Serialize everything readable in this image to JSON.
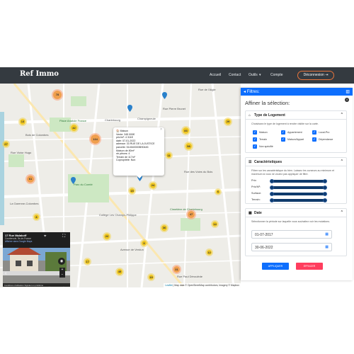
{
  "navbar": {
    "brand": "Ref Immo",
    "links": [
      "Accueil",
      "Contact",
      "Outils",
      "Compte"
    ],
    "outils_caret": "▾",
    "logout_label": "Déconnexion"
  },
  "map": {
    "places": [
      {
        "text": "Place Anatole France",
        "style": "green"
      },
      {
        "text": "Cimetière de Charlebourg",
        "style": "green"
      },
      {
        "text": "Champigneule",
        "style": ""
      },
      {
        "text": "Rue Pierre Brunet",
        "style": ""
      },
      {
        "text": "Charlebourg",
        "style": ""
      },
      {
        "text": "Rue Victor Hugo",
        "style": ""
      },
      {
        "text": "Parc du Comté",
        "style": "green"
      },
      {
        "text": "Bois de Colombes",
        "style": ""
      },
      {
        "text": "La Garenne-Colombes",
        "style": ""
      },
      {
        "text": "Rue de l'Aigle",
        "style": ""
      },
      {
        "text": "Rue des Voies du Bois",
        "style": ""
      },
      {
        "text": "Avenue de Verdun",
        "style": ""
      },
      {
        "text": "Collège Les Champs-Philippe",
        "style": ""
      },
      {
        "text": "Rue Paul Déroulède",
        "style": ""
      }
    ],
    "clusters": [
      {
        "label": "78",
        "color": "orange"
      },
      {
        "label": "13",
        "color": "yellow"
      },
      {
        "label": "42",
        "color": "yellow"
      },
      {
        "label": "134",
        "color": "orange"
      },
      {
        "label": "83",
        "color": "yellow"
      },
      {
        "label": "29",
        "color": "yellow"
      },
      {
        "label": "58",
        "color": "yellow"
      },
      {
        "label": "11",
        "color": "yellow"
      },
      {
        "label": "47",
        "color": "orange"
      },
      {
        "label": "24",
        "color": "yellow"
      },
      {
        "label": "15",
        "color": "yellow"
      },
      {
        "label": "8",
        "color": "yellow"
      },
      {
        "label": "61",
        "color": "orange"
      },
      {
        "label": "36",
        "color": "yellow"
      },
      {
        "label": "9",
        "color": "yellow"
      },
      {
        "label": "22",
        "color": "yellow"
      },
      {
        "label": "17",
        "color": "yellow"
      },
      {
        "label": "45",
        "color": "yellow"
      },
      {
        "label": "12",
        "color": "yellow"
      },
      {
        "label": "31",
        "color": "orange"
      },
      {
        "label": "6",
        "color": "yellow"
      },
      {
        "label": "19",
        "color": "yellow"
      },
      {
        "label": "27",
        "color": "yellow"
      },
      {
        "label": "14",
        "color": "yellow"
      }
    ],
    "popup": {
      "lines": [
        "🏠 Maison",
        "Vente: 345 000€",
        "prix/m²: 4 311€",
        "date: 07-01-2022",
        "adresse: 33 RUE DE LA JUSTICE",
        "parcelle: 514540000BH0445",
        "Maison de 80m²",
        "nb pièces: 4",
        "Terrain de 117m²",
        "Copropriété: Non"
      ],
      "close": "×"
    },
    "streetview": {
      "title": "17 Rue Malakoff",
      "subtitle": "Courbevoie, Île-de-France",
      "link": "Afficher dans Google Maps",
      "footer": "Conditions d'utilisation   Signaler un problème"
    },
    "attribution": {
      "leaflet": "Leaflet",
      "text": " | Map data © OpenStreetMap contributors, Imagery © Mapbox"
    },
    "zoom": {
      "in": "+",
      "out": "−"
    }
  },
  "panel": {
    "header": "Filtres:",
    "info": "i",
    "title": "Affiner la sélection:",
    "type_section": {
      "heading": "Type de Logement",
      "desc": "Choisissez le type de logement à rendre visible sur la carte.",
      "options": [
        "Maison",
        "Appartement",
        "Local-Pro",
        "Terrain",
        "Maison/Appart",
        "Dépendance",
        "Non spécifié"
      ],
      "check": "✓"
    },
    "char_section": {
      "heading": "Caractéristiques",
      "desc": "Filtrer sur les caractéristique du bien. Laissez les curseurs au minimum et maximum si vous ne voulez pas appliquer de filtre.",
      "sliders": [
        "Prix:",
        "Prix/M²:",
        "Surface:",
        "Terrain:"
      ]
    },
    "date_section": {
      "heading": "Date",
      "desc": "Sélectionner la période sur laquelle vous souhaitez voir les mutations.",
      "from": "01-07-2017",
      "to": "30-06-2022"
    },
    "apply_label": "APPLIQUER",
    "clear_label": "EFFACER"
  },
  "colors": {
    "accent": "#0d6efd",
    "navbar": "#343a40",
    "danger": "#ff3d5e",
    "logout_border": "#e8743b"
  }
}
